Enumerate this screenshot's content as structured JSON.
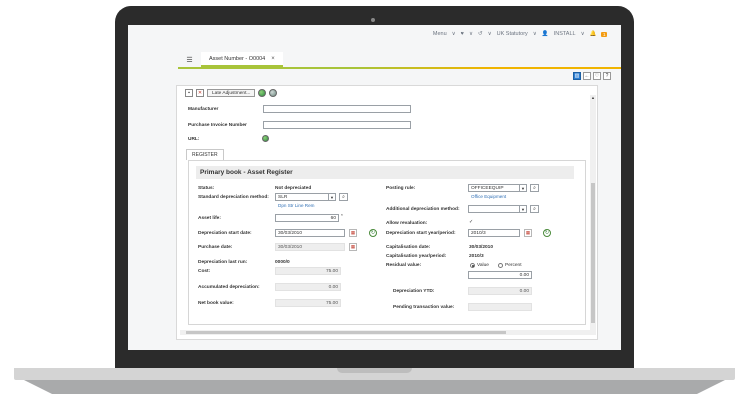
{
  "topnav": {
    "menu": "Menu",
    "statutory": "UK Statutory",
    "install": "INSTALL",
    "notif_count": "1"
  },
  "tab": {
    "title": "Asset Number - O0004"
  },
  "toolbar": {
    "late_adjustment": "Late Adjustment..."
  },
  "general": {
    "manufacturer_label": "Manufacturer",
    "purchase_invoice_label": "Purchase Invoice Number",
    "url_label": "URL:"
  },
  "register_tab": "REGISTER",
  "section_title": "Primary book - Asset Register",
  "left": {
    "status_label": "Status:",
    "status_value": "Not depreciated",
    "method_label": "Standard depreciation method:",
    "method_value": "SLR",
    "method_link": "Dpn Str Line Rem",
    "life_label": "Asset life:",
    "life_value": "60",
    "dep_start_label": "Depreciation start date:",
    "dep_start_value": "30/03/2010",
    "purchase_date_label": "Purchase date:",
    "purchase_date_value": "30/03/2010",
    "last_run_label": "Depreciation last run:",
    "last_run_value": "0000/0",
    "cost_label": "Cost:",
    "cost_value": "75.00",
    "accum_label": "Accumulated depreciation:",
    "accum_value": "0.00",
    "nbv_label": "Net book value:",
    "nbv_value": "75.00"
  },
  "right": {
    "posting_label": "Posting rule:",
    "posting_value": "OFFICEEQUIP",
    "posting_link": "Office Equipment",
    "add_method_label": "Additional depreciation method:",
    "allow_reval_label": "Allow revaluation:",
    "allow_reval_value": "✓",
    "dep_start_yp_label": "Depreciation start year/period:",
    "dep_start_yp_value": "2010/3",
    "cap_date_label": "Capitalisation date:",
    "cap_date_value": "30/03/2010",
    "cap_yp_label": "Capitalisation year/period:",
    "cap_yp_value": "2010/3",
    "residual_label": "Residual value:",
    "residual_opt_value": "Value",
    "residual_opt_percent": "Percent",
    "residual_value": "0.00",
    "ytd_label": "Depreciation YTD:",
    "ytd_value": "0.00",
    "pending_label": "Pending transaction value:"
  }
}
